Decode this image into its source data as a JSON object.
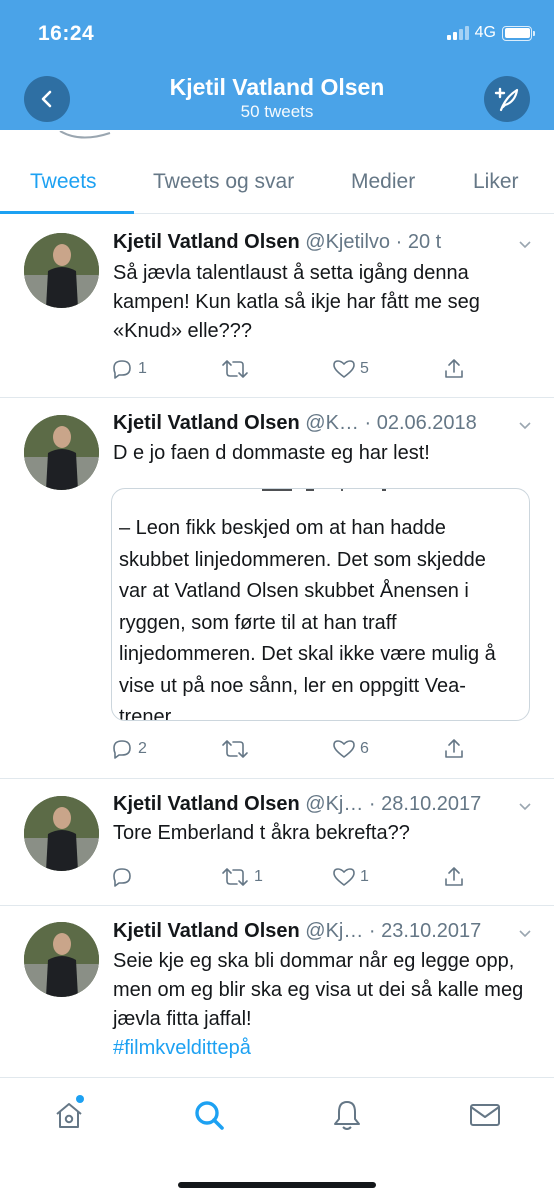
{
  "status_bar": {
    "time": "16:24",
    "network": "4G"
  },
  "header": {
    "name": "Kjetil Vatland Olsen",
    "tweet_count": "50 tweets"
  },
  "tabs": [
    {
      "label": "Tweets",
      "active": true
    },
    {
      "label": "Tweets og svar",
      "active": false
    },
    {
      "label": "Medier",
      "active": false
    },
    {
      "label": "Liker",
      "active": false
    }
  ],
  "tweets": [
    {
      "name": "Kjetil Vatland Olsen",
      "meta": "@Kjetilvo · 20 t",
      "text": "Så jævla talentlaust å setta igång denna kampen! Kun katla så ikje har fått me seg «Knud» elle???",
      "replies": "1",
      "retweets": "",
      "likes": "5"
    },
    {
      "name": "Kjetil Vatland Olsen",
      "meta": "@K… · 02.06.2018",
      "text": "D e jo faen d dommaste eg har lest!",
      "quote": "– Leon fikk beskjed om at han hadde skubbet linjedommeren. Det som skjedde var at Vatland Olsen skubbet Ånensen i ryggen, som førte til at han traff linjedommeren. Det skal ikke være mulig å vise ut på noe sånn, ler en oppgitt Vea-trener.",
      "replies": "2",
      "retweets": "",
      "likes": "6"
    },
    {
      "name": "Kjetil Vatland Olsen",
      "meta": "@Kj… · 28.10.2017",
      "text": "Tore Emberland t åkra bekrefta??",
      "replies": "",
      "retweets": "1",
      "likes": "1"
    },
    {
      "name": "Kjetil Vatland Olsen",
      "meta": "@Kj… · 23.10.2017",
      "text": "Seie kje eg ska bli dommar når eg legge opp, men om eg blir ska eg visa ut dei så kalle meg jævla fitta jaffal!",
      "hashtag": "#filmkveldittepå"
    }
  ],
  "colors": {
    "header": "#4aa3e8",
    "accent": "#1da1f2",
    "muted": "#657786",
    "border": "#e1e8ed"
  },
  "icons": [
    "back-arrow-icon",
    "compose-feather-icon",
    "reply-icon",
    "retweet-icon",
    "like-heart-icon",
    "share-icon",
    "home-icon",
    "search-icon",
    "notifications-bell-icon",
    "messages-mail-icon"
  ]
}
